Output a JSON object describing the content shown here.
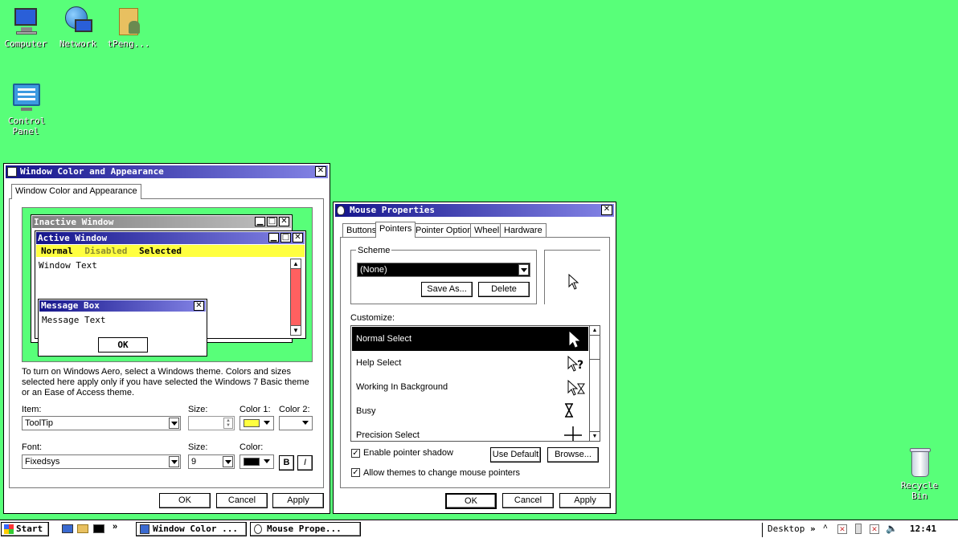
{
  "desktop": {
    "icons": [
      {
        "label": "Computer"
      },
      {
        "label": "Network"
      },
      {
        "label": "tPeng..."
      },
      {
        "label": "Control Panel"
      },
      {
        "label": "Recycle Bin"
      }
    ]
  },
  "wca": {
    "title": "Window Color and Appearance",
    "tab": "Window Color and Appearance",
    "preview": {
      "inactive_title": "Inactive Window",
      "active_title": "Active Window",
      "menu_normal": "Normal",
      "menu_disabled": "Disabled",
      "menu_selected": "Selected",
      "window_text": "Window Text",
      "msgbox_title": "Message Box",
      "msgbox_text": "Message Text",
      "msgbox_ok": "OK"
    },
    "info": "To turn on Windows Aero, select a Windows theme.  Colors and sizes selected here apply only if you have selected the Windows 7 Basic theme or an Ease of Access theme.",
    "item_label": "Item:",
    "item_value": "ToolTip",
    "size_label": "Size:",
    "color1_label": "Color 1:",
    "color2_label": "Color 2:",
    "font_label": "Font:",
    "font_value": "Fixedsys",
    "font_size_label": "Size:",
    "font_size_value": "9",
    "color_label": "Color:",
    "bold": "B",
    "italic": "I",
    "ok": "OK",
    "cancel": "Cancel",
    "apply": "Apply",
    "color1_hex": "#ffff40",
    "font_color_hex": "#000000"
  },
  "mouse": {
    "title": "Mouse Properties",
    "tabs": [
      "Buttons",
      "Pointers",
      "Pointer Options",
      "Wheel",
      "Hardware"
    ],
    "scheme_label": "Scheme",
    "scheme_value": "(None)",
    "save_as": "Save As...",
    "delete": "Delete",
    "customize_label": "Customize:",
    "cursors": [
      {
        "name": "Normal Select",
        "glyph": "arrow-cursor-icon"
      },
      {
        "name": "Help Select",
        "glyph": "help-cursor-icon"
      },
      {
        "name": "Working In Background",
        "glyph": "working-cursor-icon"
      },
      {
        "name": "Busy",
        "glyph": "hourglass-icon"
      },
      {
        "name": "Precision Select",
        "glyph": "crosshair-icon"
      }
    ],
    "enable_shadow": "Enable pointer shadow",
    "allow_themes": "Allow themes to change mouse pointers",
    "use_default": "Use Default",
    "browse": "Browse...",
    "ok": "OK",
    "cancel": "Cancel",
    "apply": "Apply"
  },
  "taskbar": {
    "start": "Start",
    "tasks": [
      {
        "label": "Window Color ..."
      },
      {
        "label": "Mouse Prope..."
      }
    ],
    "desktop": "Desktop",
    "clock": "12:41"
  }
}
